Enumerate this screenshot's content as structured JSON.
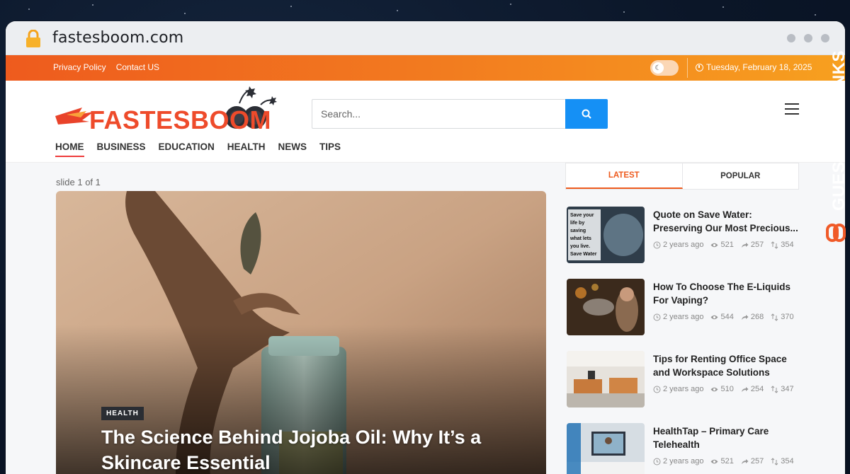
{
  "browser": {
    "url": "fastesboom.com"
  },
  "topbar": {
    "links": [
      "Privacy Policy",
      "Contact US"
    ],
    "date": "Tuesday, February 18, 2025"
  },
  "header": {
    "logo_text": "FASTESBOOM",
    "search_placeholder": "Search...",
    "nav": [
      "HOME",
      "BUSINESS",
      "EDUCATION",
      "HEALTH",
      "NEWS",
      "TIPS"
    ]
  },
  "slider": {
    "label": "slide 1 of 1",
    "badge": "HEALTH",
    "title": "The Science Behind Jojoba Oil: Why It’s a Skincare Essential"
  },
  "sidebar": {
    "tabs": [
      "LATEST",
      "POPULAR"
    ],
    "posts": [
      {
        "title": "Quote on Save Water: Preserving Our Most Precious...",
        "time": "2 years ago",
        "views": "521",
        "shares": "257",
        "comments": "354"
      },
      {
        "title": "How To Choose The E-Liquids For Vaping?",
        "time": "2 years ago",
        "views": "544",
        "shares": "268",
        "comments": "370"
      },
      {
        "title": "Tips for Renting Office Space and Workspace Solutions",
        "time": "2 years ago",
        "views": "510",
        "shares": "254",
        "comments": "347"
      },
      {
        "title": "HealthTap – Primary Care Telehealth",
        "time": "2 years ago",
        "views": "521",
        "shares": "257",
        "comments": "354"
      }
    ],
    "thumb1_text": [
      "Save your",
      "life by",
      "saving",
      "what lets",
      "you live.",
      "Save Water"
    ]
  },
  "watermark": {
    "text": "GUESTPOSTLINKS"
  },
  "colors": {
    "accent": "#ee5b1e",
    "search_button": "#1590f5",
    "nav_active": "#ee3b3b"
  }
}
